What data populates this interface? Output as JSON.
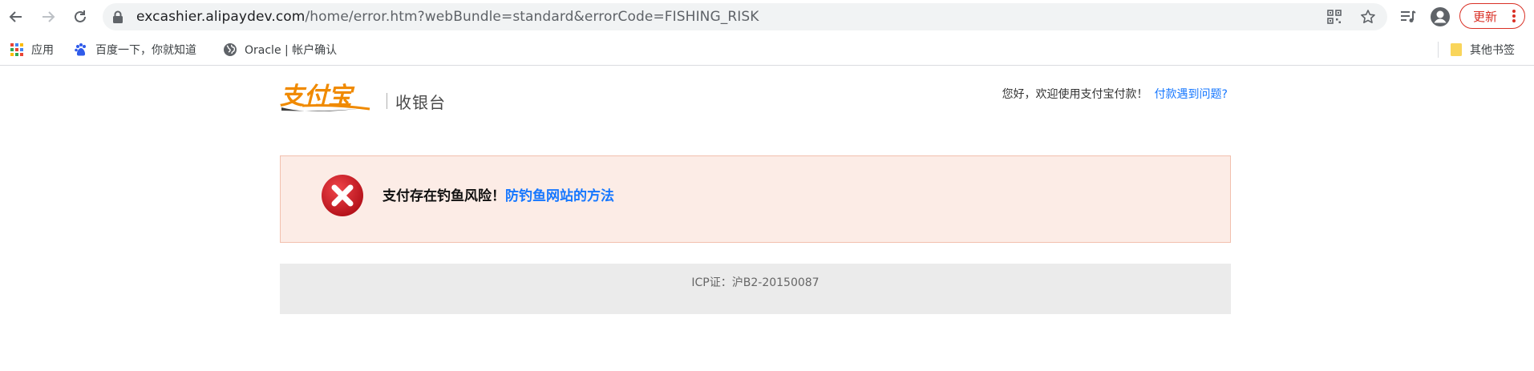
{
  "browser": {
    "url_host": "excashier.alipaydev.com",
    "url_path": "/home/error.htm?webBundle=standard&errorCode=FISHING_RISK",
    "update_label": "更新",
    "nav_icons": [
      "back-arrow-icon",
      "forward-arrow-icon",
      "reload-icon"
    ],
    "omnibox_icons": [
      "lock-icon",
      "qr-code-icon",
      "bookmark-star-icon"
    ],
    "toolbar_icons": [
      "reading-list-icon",
      "profile-avatar-icon",
      "more-menu-icon"
    ]
  },
  "bookmarks": {
    "items": [
      {
        "label": "应用",
        "icon": "apps-grid-icon"
      },
      {
        "label": "百度一下，你就知道",
        "icon": "baidu-paw-icon"
      },
      {
        "label": "Oracle | 帐户确认",
        "icon": "globe-icon"
      }
    ],
    "other_label": "其他书签",
    "other_icon": "folder-icon"
  },
  "page": {
    "logo_text": "支付宝",
    "cashier_label": "收银台",
    "greeting": "您好，欢迎使用支付宝付款！",
    "help_link": "付款遇到问题?",
    "error_message": "支付存在钓鱼风险！",
    "error_link": "防钓鱼网站的方法",
    "icp": "ICP证：沪B2-20150087"
  },
  "colors": {
    "link": "#1677ff",
    "error_bg": "#fcece6",
    "error_border": "#f2c0ae",
    "error_icon": "#d0202a",
    "logo_orange": "#f08a00",
    "update_red": "#d93025"
  }
}
